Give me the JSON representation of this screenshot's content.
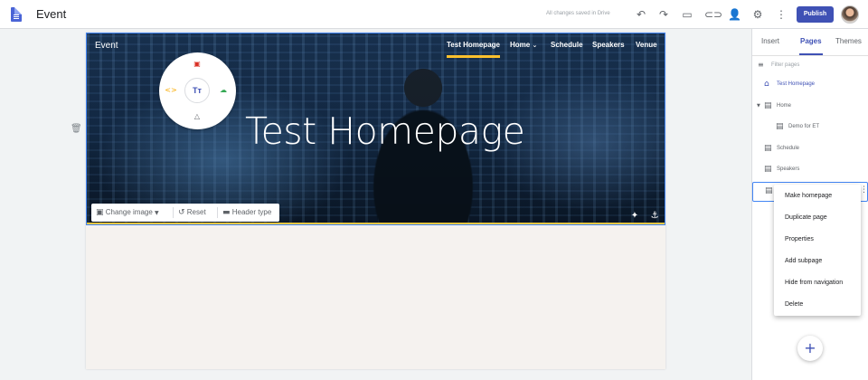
{
  "app": {
    "title": "Event",
    "save_status": "All changes saved in Drive"
  },
  "toolbar": {
    "undo_icon": "undo-icon",
    "redo_icon": "redo-icon",
    "preview_icon": "preview-icon",
    "link_icon": "link-icon",
    "share_icon": "share-icon",
    "settings_icon": "gear-icon",
    "more_icon": "more-vert-icon",
    "publish_label": "Publish"
  },
  "site": {
    "name": "Event",
    "nav": [
      "Test Homepage",
      "Home",
      "Schedule",
      "Speakers",
      "Venue"
    ],
    "active_nav": "Test Homepage",
    "hero_title": "Test Homepage",
    "accent_color": "#fbc02d"
  },
  "image_toolbar": {
    "change_image": "Change image",
    "reset": "Reset",
    "header_type": "Header type"
  },
  "side_panel": {
    "tabs": [
      "Insert",
      "Pages",
      "Themes"
    ],
    "active_tab": "Pages",
    "filter_placeholder": "Filter pages",
    "pages": [
      {
        "label": "Test Homepage",
        "home": true
      },
      {
        "label": "Home",
        "expanded": true
      },
      {
        "label": "Demo for ET",
        "child": true
      },
      {
        "label": "Schedule"
      },
      {
        "label": "Speakers"
      }
    ]
  },
  "context_menu": {
    "items": [
      "Make homepage",
      "Duplicate page",
      "Properties",
      "Add subpage",
      "Hide from navigation",
      "Delete"
    ]
  },
  "colors": {
    "primary": "#3f51b5",
    "selection": "#4285f4"
  }
}
